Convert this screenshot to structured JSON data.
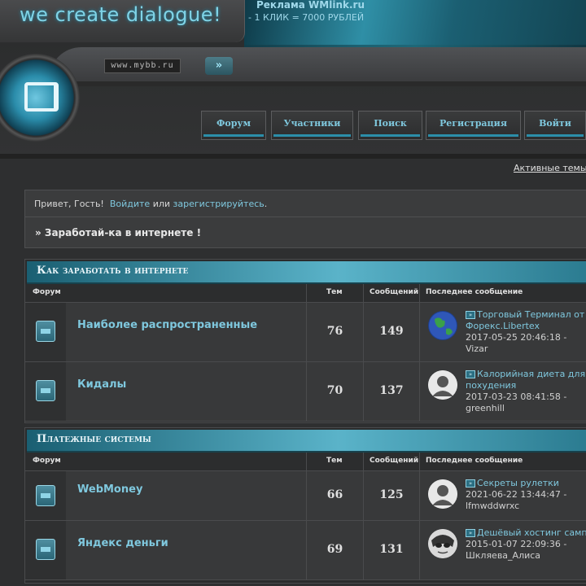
{
  "header": {
    "logo_text": "we create dialogue!",
    "ad_title": "Реклама WMlink.ru",
    "ad_sub": "- 1 КЛИК = 7000 РУБЛЕЙ",
    "url_text": "www.mybb.ru",
    "arrow": "»"
  },
  "nav": {
    "items": [
      {
        "label": "Форум"
      },
      {
        "label": "Участники"
      },
      {
        "label": "Поиск"
      },
      {
        "label": "Регистрация"
      },
      {
        "label": "Войти"
      }
    ]
  },
  "active_topics": "Активные темы",
  "welcome": {
    "greeting": "Привет, Гость!",
    "login": "Войдите",
    "or": "или",
    "register": "зарегистрируйтесь",
    "dot": ".",
    "news": "» Заработай-ка в интернете !"
  },
  "columns": {
    "forum": "Форум",
    "topics": "Тем",
    "posts": "Сообщений",
    "last": "Последнее сообщение"
  },
  "categories": [
    {
      "title": "Как заработать в интернете",
      "forums": [
        {
          "name": "Наиболее распространенные",
          "topics": "76",
          "posts": "149",
          "last_title": "Торговый Терминал от Форекс.Libertex",
          "last_date": "2017-05-25 20:46:18 -",
          "last_user": "Vizar",
          "avatar": "globe"
        },
        {
          "name": "Кидалы",
          "topics": "70",
          "posts": "137",
          "last_title": "Калорийная диета для похудения",
          "last_date": "2017-03-23 08:41:58 -",
          "last_user": "greenhill",
          "avatar": "user"
        }
      ]
    },
    {
      "title": "Платежные системы",
      "forums": [
        {
          "name": "WebMoney",
          "topics": "66",
          "posts": "125",
          "last_title": "Секреты рулетки",
          "last_date": "2021-06-22 13:44:47 -",
          "last_user": "lfmwddwrxc",
          "avatar": "user"
        },
        {
          "name": "Яндекс деньги",
          "topics": "69",
          "posts": "131",
          "last_title": "Дешёвый хостинг сампа",
          "last_date": "2015-01-07 22:09:36 -",
          "last_user": "Шкляева_Алиса",
          "avatar": "anime"
        }
      ]
    }
  ],
  "colors": {
    "accent": "#7fc8de",
    "header_bar": "#2b8ea9"
  }
}
